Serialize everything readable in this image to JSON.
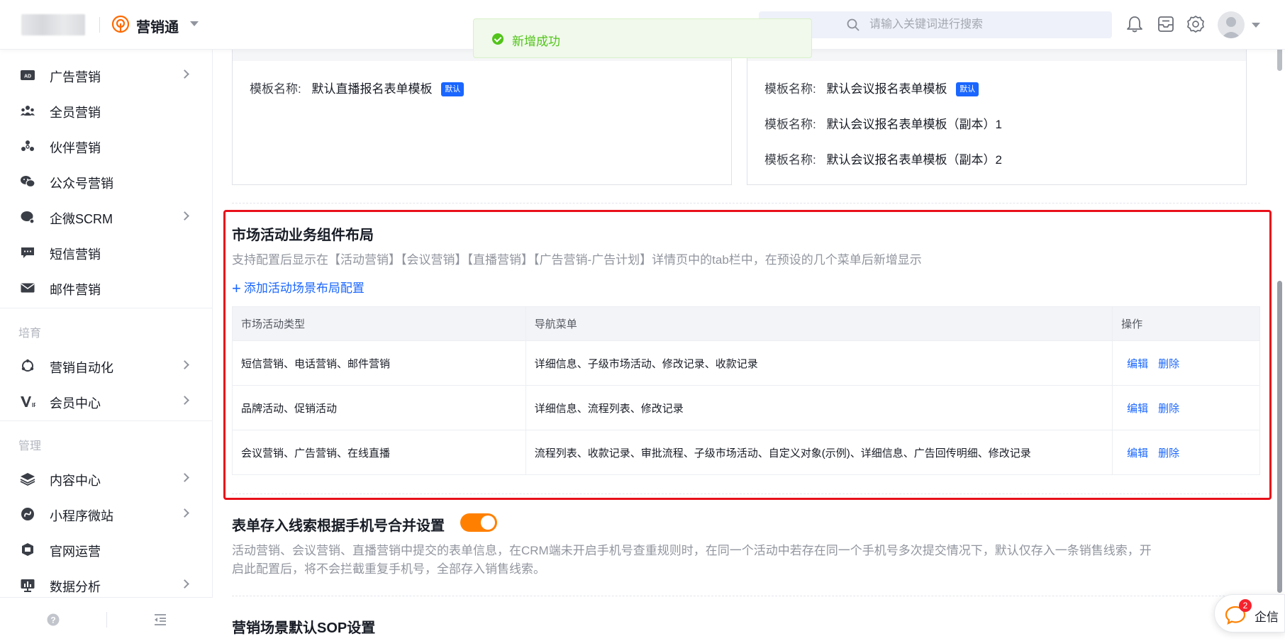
{
  "header": {
    "app_name": "营销通",
    "search_placeholder": "请输入关键词进行搜索"
  },
  "toast": {
    "message": "新增成功"
  },
  "sidebar": {
    "items": [
      {
        "label": "广告营销",
        "icon": "ad-icon",
        "has_children": true
      },
      {
        "label": "全员营销",
        "icon": "team-icon",
        "has_children": false
      },
      {
        "label": "伙伴营销",
        "icon": "partner-icon",
        "has_children": false
      },
      {
        "label": "公众号营销",
        "icon": "wechat-icon",
        "has_children": false
      },
      {
        "label": "企微SCRM",
        "icon": "wecom-icon",
        "has_children": true
      },
      {
        "label": "短信营销",
        "icon": "sms-icon",
        "has_children": false
      },
      {
        "label": "邮件营销",
        "icon": "mail-icon",
        "has_children": false
      }
    ],
    "group_nurture": "培育",
    "nurture_items": [
      {
        "label": "营销自动化",
        "icon": "automation-icon",
        "has_children": true
      },
      {
        "label": "会员中心",
        "icon": "vip-icon",
        "has_children": true
      }
    ],
    "group_manage": "管理",
    "manage_items": [
      {
        "label": "内容中心",
        "icon": "layers-icon",
        "has_children": true
      },
      {
        "label": "小程序微站",
        "icon": "miniprogram-icon",
        "has_children": true
      },
      {
        "label": "官网运营",
        "icon": "website-icon",
        "has_children": false
      },
      {
        "label": "数据分析",
        "icon": "analytics-icon",
        "has_children": true
      }
    ]
  },
  "templates": {
    "label": "模板名称:",
    "default_tag": "默认",
    "live_template": "默认直播报名表单模板",
    "meeting_templates": [
      "默认会议报名表单模板",
      "默认会议报名表单模板（副本）1",
      "默认会议报名表单模板（副本）2"
    ]
  },
  "layout_section": {
    "title": "市场活动业务组件布局",
    "description": "支持配置后显示在【活动营销】【会议营销】【直播营销】【广告营销-广告计划】详情页中的tab栏中，在预设的几个菜单后新增显示",
    "add_label": "添加活动场景布局配置",
    "columns": [
      "市场活动类型",
      "导航菜单",
      "操作"
    ],
    "rows": [
      {
        "type": "短信营销、电话营销、邮件营销",
        "menu": "详细信息、子级市场活动、修改记录、收款记录"
      },
      {
        "type": "品牌活动、促销活动",
        "menu": "详细信息、流程列表、修改记录"
      },
      {
        "type": "会议营销、广告营销、在线直播",
        "menu": "流程列表、收款记录、审批流程、子级市场活动、自定义对象(示例)、详细信息、广告回传明细、修改记录"
      }
    ],
    "edit_label": "编辑",
    "delete_label": "删除"
  },
  "merge_section": {
    "title": "表单存入线索根据手机号合并设置",
    "toggle_on": true,
    "description": "活动营销、会议营销、直播营销中提交的表单信息，在CRM端未开启手机号查重规则时，在同一个活动中若存在同一个手机号多次提交情况下，默认仅存入一条销售线索，开启此配置后，将不会拦截重复手机号，全部存入销售线索。"
  },
  "sop_section": {
    "title": "营销场景默认SOP设置"
  },
  "chat_widget": {
    "badge": "2",
    "label": "企信"
  },
  "colors": {
    "accent": "#1a66ff",
    "toggle": "#ff8000",
    "highlight": "#e8101a",
    "success": "#52c41a"
  }
}
